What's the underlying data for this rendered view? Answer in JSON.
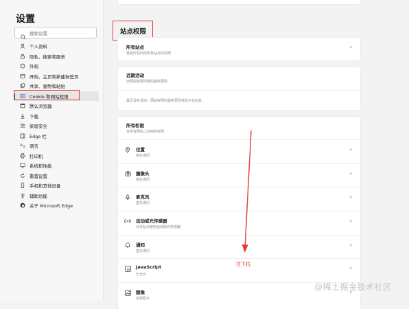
{
  "sidebar": {
    "title": "设置",
    "search_placeholder": "搜索设置",
    "items": [
      {
        "label": "个人资料",
        "icon": "profile-icon"
      },
      {
        "label": "隐私、搜索和服务",
        "icon": "lock-icon"
      },
      {
        "label": "外观",
        "icon": "appearance-icon"
      },
      {
        "label": "开始、主页和新建标签页",
        "icon": "home-icon"
      },
      {
        "label": "共享、复制和粘贴",
        "icon": "share-icon"
      },
      {
        "label": "Cookie 和网站权限",
        "icon": "cookie-icon"
      },
      {
        "label": "默认浏览器",
        "icon": "browser-icon"
      },
      {
        "label": "下载",
        "icon": "download-icon"
      },
      {
        "label": "家庭安全",
        "icon": "family-icon"
      },
      {
        "label": "Edge 栏",
        "icon": "edge-bar-icon"
      },
      {
        "label": "语言",
        "icon": "language-icon"
      },
      {
        "label": "打印机",
        "icon": "printer-icon"
      },
      {
        "label": "系统和性能",
        "icon": "system-icon"
      },
      {
        "label": "重置设置",
        "icon": "reset-icon"
      },
      {
        "label": "手机和其他设备",
        "icon": "phone-icon"
      },
      {
        "label": "辅助功能",
        "icon": "accessibility-icon"
      },
      {
        "label": "关于 Microsoft Edge",
        "icon": "edge-logo-icon"
      }
    ]
  },
  "main": {
    "title": "站点权限",
    "all_sites": {
      "title": "所有站点",
      "subtitle": "查看你访问的所有站点的权限"
    },
    "recent": {
      "title": "近期活动",
      "subtitle": "对网站权限所做的最新更改",
      "empty": "最近没有活动。网站权限的最新更改将显示在此处"
    },
    "all_permissions": {
      "title": "所有权限",
      "subtitle": "在所有网站上应用的权限",
      "items": [
        {
          "title": "位置",
          "subtitle": "首先询问",
          "icon": "location-icon"
        },
        {
          "title": "摄像头",
          "subtitle": "首先询问",
          "icon": "camera-icon"
        },
        {
          "title": "麦克风",
          "subtitle": "首先询问",
          "icon": "microphone-icon"
        },
        {
          "title": "运动或光传感器",
          "subtitle": "允许站点使用运动和光传感器",
          "icon": "sensor-icon"
        },
        {
          "title": "通知",
          "subtitle": "首先询问",
          "icon": "notification-icon"
        },
        {
          "title": "JavaScript",
          "subtitle": "已允许",
          "icon": "javascript-icon"
        },
        {
          "title": "图像",
          "subtitle": "全部显示",
          "icon": "image-icon"
        }
      ]
    }
  },
  "annotation": {
    "text": "往下拉"
  },
  "watermark": "@稀土掘金技术社区"
}
